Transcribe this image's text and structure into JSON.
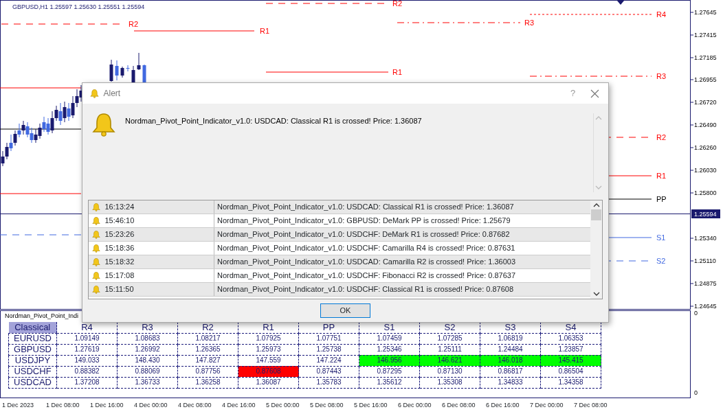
{
  "chart": {
    "header": "GBPUSD,H1  1.25597 1.25630 1.25551 1.25594",
    "pivot_lines": [
      {
        "label": "R2",
        "color": "#ff0000",
        "kind": "dash"
      },
      {
        "label": "R1",
        "color": "#ff0000",
        "kind": "solid"
      },
      {
        "label": "R2",
        "color": "#ff0000",
        "kind": "dash"
      },
      {
        "label": "R1",
        "color": "#ff0000",
        "kind": "solid"
      },
      {
        "label": "R3",
        "color": "#ff0000",
        "kind": "dashdot"
      },
      {
        "label": "R4",
        "color": "#ff0000",
        "kind": "dot"
      },
      {
        "label": "R3",
        "color": "#ff0000",
        "kind": "dashdot"
      },
      {
        "label": "R2",
        "color": "#ff0000",
        "kind": "dash"
      },
      {
        "label": "R1",
        "color": "#ff0000",
        "kind": "solid"
      },
      {
        "label": "PP",
        "color": "#000000",
        "kind": "solid"
      },
      {
        "label": "S1",
        "color": "#4169e1",
        "kind": "solid"
      },
      {
        "label": "S2",
        "color": "#4169e1",
        "kind": "dash"
      }
    ],
    "price_axis": [
      "1.27645",
      "1.27415",
      "1.27185",
      "1.26955",
      "1.26720",
      "1.26490",
      "1.26260",
      "1.26030",
      "1.25800",
      "1.25340",
      "1.25110",
      "1.24875",
      "1.24645"
    ],
    "current_price": "1.25594"
  },
  "indicator": {
    "title": "Nordman_Pivot_Point_Indi",
    "axis": [
      "0",
      "0"
    ],
    "table": {
      "corner": "Classical",
      "columns": [
        "R4",
        "R3",
        "R2",
        "R1",
        "PP",
        "S1",
        "S2",
        "S3",
        "S4"
      ],
      "rows": [
        {
          "symbol": "EURUSD",
          "cells": [
            {
              "text": "1.09149"
            },
            {
              "text": "1.08683"
            },
            {
              "text": "1.08217"
            },
            {
              "text": "1.07925"
            },
            {
              "text": "1.07751"
            },
            {
              "text": "1.07459"
            },
            {
              "text": "1.07285"
            },
            {
              "text": "1.06819"
            },
            {
              "text": "1.06353"
            }
          ]
        },
        {
          "symbol": "GBPUSD",
          "cells": [
            {
              "text": "1.27619"
            },
            {
              "text": "1.26992"
            },
            {
              "text": "1.26365"
            },
            {
              "text": "1.25973"
            },
            {
              "text": "1.25738"
            },
            {
              "text": "1.25346"
            },
            {
              "text": "1.25111"
            },
            {
              "text": "1.24484"
            },
            {
              "text": "1.23857"
            }
          ]
        },
        {
          "symbol": "USDJPY",
          "cells": [
            {
              "text": "149.033"
            },
            {
              "text": "148.430"
            },
            {
              "text": "147.827"
            },
            {
              "text": "147.559"
            },
            {
              "text": "147.224"
            },
            {
              "text": "146.956",
              "color": "#00ff00"
            },
            {
              "text": "146.621",
              "color": "#00ff00"
            },
            {
              "text": "146.018",
              "color": "#00ff00"
            },
            {
              "text": "145.415",
              "color": "#00ff00"
            }
          ]
        },
        {
          "symbol": "USDCHF",
          "cells": [
            {
              "text": "0.88382"
            },
            {
              "text": "0.88069"
            },
            {
              "text": "0.87756"
            },
            {
              "text": "0.87608",
              "color": "#ff0000"
            },
            {
              "text": "0.87443"
            },
            {
              "text": "0.87295"
            },
            {
              "text": "0.87130"
            },
            {
              "text": "0.86817"
            },
            {
              "text": "0.86504"
            }
          ]
        },
        {
          "symbol": "USDCAD",
          "cells": [
            {
              "text": "1.37208"
            },
            {
              "text": "1.36733"
            },
            {
              "text": "1.36258"
            },
            {
              "text": "1.36087"
            },
            {
              "text": "1.35783"
            },
            {
              "text": "1.35612"
            },
            {
              "text": "1.35308"
            },
            {
              "text": "1.34833"
            },
            {
              "text": "1.34358"
            }
          ]
        }
      ]
    }
  },
  "time_axis": [
    "1 Dec 2023",
    "1 Dec 08:00",
    "1 Dec 16:00",
    "4 Dec 00:00",
    "4 Dec 08:00",
    "4 Dec 16:00",
    "5 Dec 00:00",
    "5 Dec 08:00",
    "5 Dec 16:00",
    "6 Dec 00:00",
    "6 Dec 08:00",
    "6 Dec 16:00",
    "7 Dec 00:00",
    "7 Dec 08:00"
  ],
  "alert_dialog": {
    "title": "Alert",
    "help": "?",
    "message": "Nordman_Pivot_Point_Indicator_v1.0: USDCAD: Classical R1 is crossed! Price: 1.36087",
    "history": [
      {
        "time": "16:13:24",
        "message": "Nordman_Pivot_Point_Indicator_v1.0: USDCAD: Classical R1 is crossed! Price: 1.36087"
      },
      {
        "time": "15:46:10",
        "message": "Nordman_Pivot_Point_Indicator_v1.0: GBPUSD: DeMark PP is crossed! Price: 1.25679"
      },
      {
        "time": "15:23:26",
        "message": "Nordman_Pivot_Point_Indicator_v1.0: USDCHF: DeMark R1 is crossed! Price: 0.87682"
      },
      {
        "time": "15:18:36",
        "message": "Nordman_Pivot_Point_Indicator_v1.0: USDCHF: Camarilla R4 is crossed! Price: 0.87631"
      },
      {
        "time": "15:18:32",
        "message": "Nordman_Pivot_Point_Indicator_v1.0: USDCAD: Camarilla R2 is crossed! Price: 1.36003"
      },
      {
        "time": "15:17:08",
        "message": "Nordman_Pivot_Point_Indicator_v1.0: USDCHF: Fibonacci R2 is crossed! Price: 0.87637"
      },
      {
        "time": "15:11:50",
        "message": "Nordman_Pivot_Point_Indicator_v1.0: USDCHF: Classical R1 is crossed! Price: 0.87608"
      }
    ],
    "ok_button": "OK"
  }
}
